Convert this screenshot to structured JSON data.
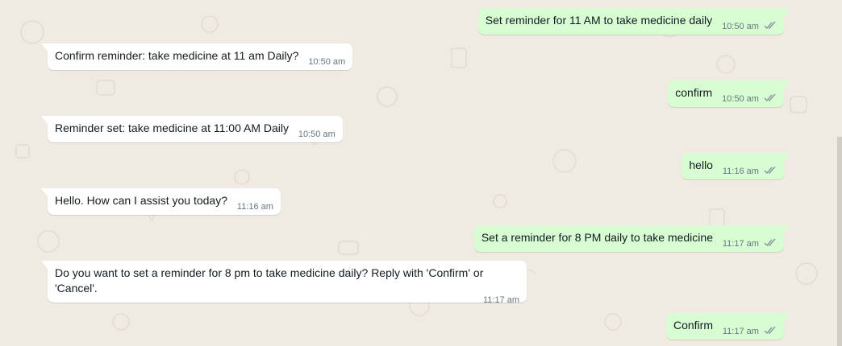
{
  "messages": [
    {
      "direction": "out",
      "text": "Set reminder for 11 AM to take medicine daily",
      "time": "10:50 am"
    },
    {
      "direction": "in",
      "text": "Confirm reminder: take medicine at 11 am Daily?",
      "time": "10:50 am"
    },
    {
      "direction": "out",
      "text": "confirm",
      "time": "10:50 am"
    },
    {
      "direction": "in",
      "text": "Reminder set: take medicine at 11:00 AM Daily",
      "time": "10:50 am"
    },
    {
      "direction": "out",
      "text": "hello",
      "time": "11:16 am"
    },
    {
      "direction": "in",
      "text": "Hello. How can I assist you today?",
      "time": "11:16 am"
    },
    {
      "direction": "out",
      "text": "Set a reminder for 8 PM daily to take medicine",
      "time": "11:17 am"
    },
    {
      "direction": "in",
      "text": "Do you want to set a reminder for 8 pm to take medicine daily? Reply with 'Confirm' or 'Cancel'.",
      "time": "11:17 am"
    },
    {
      "direction": "out",
      "text": "Confirm",
      "time": "11:17 am"
    }
  ],
  "colors": {
    "background": "#efeae2",
    "incoming_bubble": "#ffffff",
    "outgoing_bubble": "#d9fdd3",
    "text": "#111b21",
    "meta": "#667781",
    "read_tick": "#8696a0"
  },
  "icons": {
    "read_receipt": "double-check-icon"
  }
}
